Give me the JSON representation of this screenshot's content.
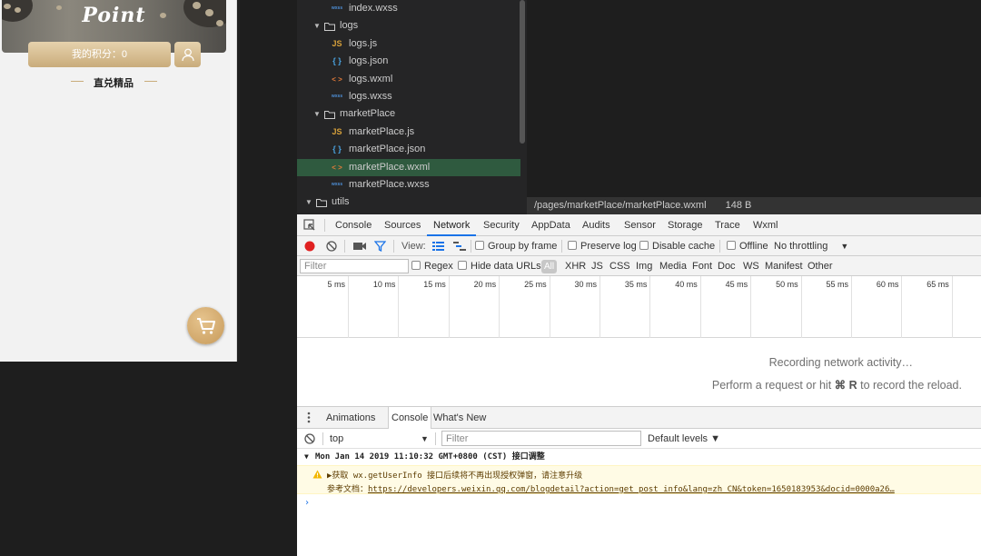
{
  "simulator": {
    "banner_title": "Point",
    "points_label": "我的积分：0",
    "section_title": "直兑精品"
  },
  "file_tree": {
    "items": [
      {
        "label": "index.wxss",
        "icon": "wxss-file-icon",
        "type": "file"
      },
      {
        "label": "logs",
        "icon": "folder-icon",
        "type": "folder"
      },
      {
        "label": "logs.js",
        "icon": "js-file-icon",
        "type": "file"
      },
      {
        "label": "logs.json",
        "icon": "json-file-icon",
        "type": "file"
      },
      {
        "label": "logs.wxml",
        "icon": "wxml-file-icon",
        "type": "file"
      },
      {
        "label": "logs.wxss",
        "icon": "wxss-file-icon",
        "type": "file"
      },
      {
        "label": "marketPlace",
        "icon": "folder-icon",
        "type": "folder"
      },
      {
        "label": "marketPlace.js",
        "icon": "js-file-icon",
        "type": "file"
      },
      {
        "label": "marketPlace.json",
        "icon": "json-file-icon",
        "type": "file"
      },
      {
        "label": "marketPlace.wxml",
        "icon": "wxml-file-icon",
        "type": "file",
        "selected": true
      },
      {
        "label": "marketPlace.wxss",
        "icon": "wxss-file-icon",
        "type": "file"
      },
      {
        "label": "utils",
        "icon": "folder-icon",
        "type": "folder"
      }
    ],
    "icon_glyphs": {
      "js": "JS",
      "json": "{ }",
      "wxml": "< >",
      "wxss": "wxss"
    }
  },
  "editor": {
    "path": "/pages/marketPlace/marketPlace.wxml",
    "size": "148 B"
  },
  "devtools": {
    "tabs": [
      "Console",
      "Sources",
      "Network",
      "Security",
      "AppData",
      "Audits",
      "Sensor",
      "Storage",
      "Trace",
      "Wxml"
    ],
    "active_tab": "Network",
    "toolbar": {
      "view_label": "View:",
      "group_by_frame": "Group by frame",
      "preserve_log": "Preserve log",
      "disable_cache": "Disable cache",
      "offline": "Offline",
      "throttling": "No throttling"
    },
    "filter_bar": {
      "placeholder": "Filter",
      "regex": "Regex",
      "hide_data_urls": "Hide data URLs",
      "all": "All",
      "types": [
        "XHR",
        "JS",
        "CSS",
        "Img",
        "Media",
        "Font",
        "Doc",
        "WS",
        "Manifest",
        "Other"
      ]
    },
    "timeline_ticks": [
      "5 ms",
      "10 ms",
      "15 ms",
      "20 ms",
      "25 ms",
      "30 ms",
      "35 ms",
      "40 ms",
      "45 ms",
      "50 ms",
      "55 ms",
      "60 ms",
      "65 ms"
    ],
    "recording_line1": "Recording network activity…",
    "recording_line2_pre": "Perform a request or hit ",
    "recording_key": "⌘ R",
    "recording_line2_post": " to record the reload.",
    "drawer": {
      "tabs": [
        "Animations",
        "Console",
        "What's New"
      ],
      "active": "Console"
    },
    "console": {
      "context": "top",
      "filter_placeholder": "Filter",
      "levels": "Default levels ▼",
      "group_header": "Mon Jan 14 2019 11:10:32 GMT+0800 (CST) 接口调整",
      "warning_line1": "▶获取 wx.getUserInfo 接口后续将不再出现授权弹窗，请注意升级",
      "warning_line2_label": "参考文档：",
      "warning_link": "https://developers.weixin.qq.com/blogdetail?action=get_post_info&lang=zh_CN&token=1650183953&docid=0000a26…",
      "prompt": "›"
    }
  }
}
